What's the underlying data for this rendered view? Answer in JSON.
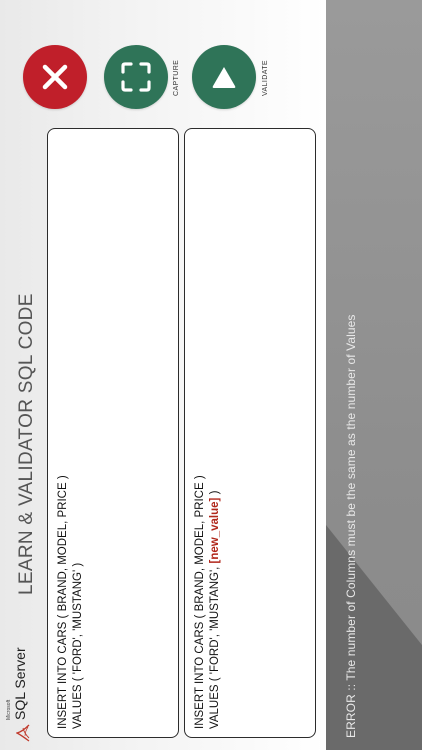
{
  "app": {
    "title": "LEARN & VALIDATOR SQL CODE",
    "logo": {
      "brand": "Microsoft",
      "product": "SQL Server"
    }
  },
  "buttons": {
    "close": {
      "icon": "close-icon"
    },
    "capture": {
      "icon": "capture-frame-icon",
      "label": "CAPTURE"
    },
    "validate": {
      "icon": "triangle-up-icon",
      "label": "VALIDATE"
    }
  },
  "editors": {
    "reference": {
      "line1": "INSERT INTO CARS ( BRAND, MODEL, PRICE )",
      "line2": "VALUES ( 'FORD', 'MUSTANG' )"
    },
    "user": {
      "line1": "INSERT INTO CARS ( BRAND, MODEL, PRICE )",
      "line2_prefix": "VALUES ( 'FORD', 'MUSTANG', ",
      "line2_token": "[new_value]",
      "line2_suffix": " )"
    }
  },
  "status": {
    "error": "ERROR ::  The number of Columns must be the same as the number of Values"
  },
  "colors": {
    "close": "#c01f2a",
    "primary": "#2f7458",
    "highlight": "#b1271b",
    "panel": "#8c8c8c"
  }
}
